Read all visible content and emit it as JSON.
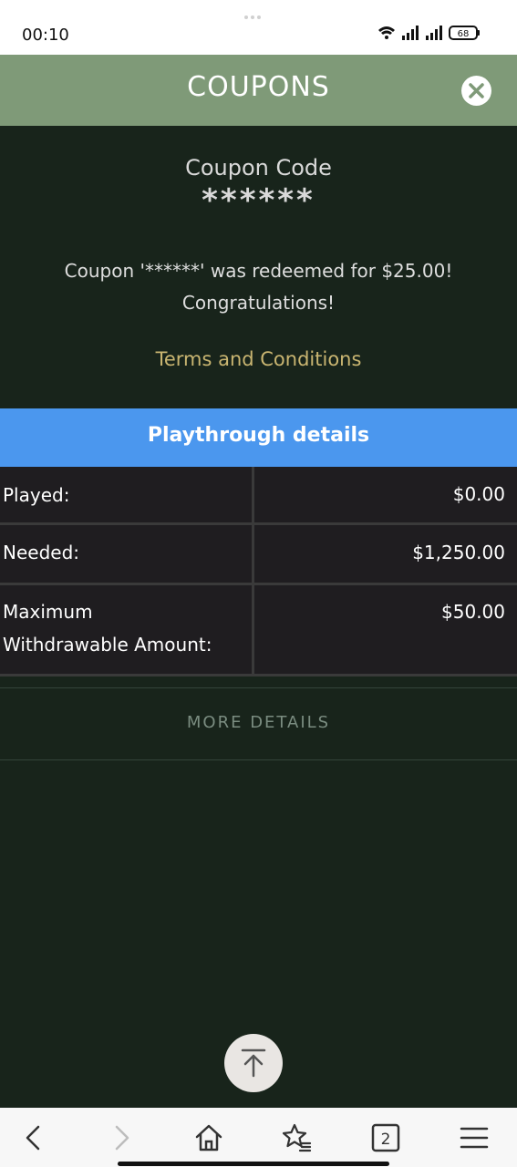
{
  "status_bar": {
    "time": "00:10",
    "battery": "68"
  },
  "header": {
    "title": "COUPONS"
  },
  "coupon": {
    "label": "Coupon Code",
    "code": "******",
    "redeem_line1": "Coupon '******' was redeemed for $25.00!",
    "redeem_line2": "Congratulations!",
    "terms_link": "Terms and Conditions"
  },
  "playthrough": {
    "title": "Playthrough details",
    "rows": [
      {
        "label": "Played:",
        "value": "$0.00"
      },
      {
        "label": "Needed:",
        "value": "$1,250.00"
      },
      {
        "label_line1": "Maximum",
        "label_line2": "Withdrawable Amount:",
        "value": "$50.00"
      }
    ]
  },
  "more_details": {
    "label": "MORE DETAILS"
  },
  "browser_nav": {
    "tab_count": "2"
  },
  "colors": {
    "header_bg": "#7f9a78",
    "page_bg": "#18241b",
    "playthrough_bar": "#4b97ee",
    "terms_link": "#c9b571",
    "table_bg": "#1f1d20"
  }
}
